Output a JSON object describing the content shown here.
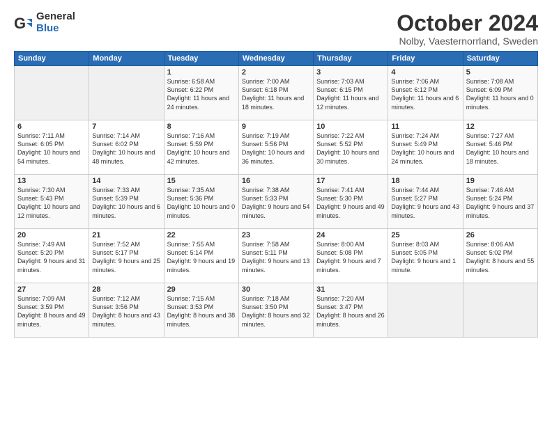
{
  "logo": {
    "general": "General",
    "blue": "Blue"
  },
  "title": "October 2024",
  "location": "Nolby, Vaesternorrland, Sweden",
  "days_header": [
    "Sunday",
    "Monday",
    "Tuesday",
    "Wednesday",
    "Thursday",
    "Friday",
    "Saturday"
  ],
  "weeks": [
    [
      {
        "num": "",
        "sunrise": "",
        "sunset": "",
        "daylight": ""
      },
      {
        "num": "",
        "sunrise": "",
        "sunset": "",
        "daylight": ""
      },
      {
        "num": "1",
        "sunrise": "Sunrise: 6:58 AM",
        "sunset": "Sunset: 6:22 PM",
        "daylight": "Daylight: 11 hours and 24 minutes."
      },
      {
        "num": "2",
        "sunrise": "Sunrise: 7:00 AM",
        "sunset": "Sunset: 6:18 PM",
        "daylight": "Daylight: 11 hours and 18 minutes."
      },
      {
        "num": "3",
        "sunrise": "Sunrise: 7:03 AM",
        "sunset": "Sunset: 6:15 PM",
        "daylight": "Daylight: 11 hours and 12 minutes."
      },
      {
        "num": "4",
        "sunrise": "Sunrise: 7:06 AM",
        "sunset": "Sunset: 6:12 PM",
        "daylight": "Daylight: 11 hours and 6 minutes."
      },
      {
        "num": "5",
        "sunrise": "Sunrise: 7:08 AM",
        "sunset": "Sunset: 6:09 PM",
        "daylight": "Daylight: 11 hours and 0 minutes."
      }
    ],
    [
      {
        "num": "6",
        "sunrise": "Sunrise: 7:11 AM",
        "sunset": "Sunset: 6:05 PM",
        "daylight": "Daylight: 10 hours and 54 minutes."
      },
      {
        "num": "7",
        "sunrise": "Sunrise: 7:14 AM",
        "sunset": "Sunset: 6:02 PM",
        "daylight": "Daylight: 10 hours and 48 minutes."
      },
      {
        "num": "8",
        "sunrise": "Sunrise: 7:16 AM",
        "sunset": "Sunset: 5:59 PM",
        "daylight": "Daylight: 10 hours and 42 minutes."
      },
      {
        "num": "9",
        "sunrise": "Sunrise: 7:19 AM",
        "sunset": "Sunset: 5:56 PM",
        "daylight": "Daylight: 10 hours and 36 minutes."
      },
      {
        "num": "10",
        "sunrise": "Sunrise: 7:22 AM",
        "sunset": "Sunset: 5:52 PM",
        "daylight": "Daylight: 10 hours and 30 minutes."
      },
      {
        "num": "11",
        "sunrise": "Sunrise: 7:24 AM",
        "sunset": "Sunset: 5:49 PM",
        "daylight": "Daylight: 10 hours and 24 minutes."
      },
      {
        "num": "12",
        "sunrise": "Sunrise: 7:27 AM",
        "sunset": "Sunset: 5:46 PM",
        "daylight": "Daylight: 10 hours and 18 minutes."
      }
    ],
    [
      {
        "num": "13",
        "sunrise": "Sunrise: 7:30 AM",
        "sunset": "Sunset: 5:43 PM",
        "daylight": "Daylight: 10 hours and 12 minutes."
      },
      {
        "num": "14",
        "sunrise": "Sunrise: 7:33 AM",
        "sunset": "Sunset: 5:39 PM",
        "daylight": "Daylight: 10 hours and 6 minutes."
      },
      {
        "num": "15",
        "sunrise": "Sunrise: 7:35 AM",
        "sunset": "Sunset: 5:36 PM",
        "daylight": "Daylight: 10 hours and 0 minutes."
      },
      {
        "num": "16",
        "sunrise": "Sunrise: 7:38 AM",
        "sunset": "Sunset: 5:33 PM",
        "daylight": "Daylight: 9 hours and 54 minutes."
      },
      {
        "num": "17",
        "sunrise": "Sunrise: 7:41 AM",
        "sunset": "Sunset: 5:30 PM",
        "daylight": "Daylight: 9 hours and 49 minutes."
      },
      {
        "num": "18",
        "sunrise": "Sunrise: 7:44 AM",
        "sunset": "Sunset: 5:27 PM",
        "daylight": "Daylight: 9 hours and 43 minutes."
      },
      {
        "num": "19",
        "sunrise": "Sunrise: 7:46 AM",
        "sunset": "Sunset: 5:24 PM",
        "daylight": "Daylight: 9 hours and 37 minutes."
      }
    ],
    [
      {
        "num": "20",
        "sunrise": "Sunrise: 7:49 AM",
        "sunset": "Sunset: 5:20 PM",
        "daylight": "Daylight: 9 hours and 31 minutes."
      },
      {
        "num": "21",
        "sunrise": "Sunrise: 7:52 AM",
        "sunset": "Sunset: 5:17 PM",
        "daylight": "Daylight: 9 hours and 25 minutes."
      },
      {
        "num": "22",
        "sunrise": "Sunrise: 7:55 AM",
        "sunset": "Sunset: 5:14 PM",
        "daylight": "Daylight: 9 hours and 19 minutes."
      },
      {
        "num": "23",
        "sunrise": "Sunrise: 7:58 AM",
        "sunset": "Sunset: 5:11 PM",
        "daylight": "Daylight: 9 hours and 13 minutes."
      },
      {
        "num": "24",
        "sunrise": "Sunrise: 8:00 AM",
        "sunset": "Sunset: 5:08 PM",
        "daylight": "Daylight: 9 hours and 7 minutes."
      },
      {
        "num": "25",
        "sunrise": "Sunrise: 8:03 AM",
        "sunset": "Sunset: 5:05 PM",
        "daylight": "Daylight: 9 hours and 1 minute."
      },
      {
        "num": "26",
        "sunrise": "Sunrise: 8:06 AM",
        "sunset": "Sunset: 5:02 PM",
        "daylight": "Daylight: 8 hours and 55 minutes."
      }
    ],
    [
      {
        "num": "27",
        "sunrise": "Sunrise: 7:09 AM",
        "sunset": "Sunset: 3:59 PM",
        "daylight": "Daylight: 8 hours and 49 minutes."
      },
      {
        "num": "28",
        "sunrise": "Sunrise: 7:12 AM",
        "sunset": "Sunset: 3:56 PM",
        "daylight": "Daylight: 8 hours and 43 minutes."
      },
      {
        "num": "29",
        "sunrise": "Sunrise: 7:15 AM",
        "sunset": "Sunset: 3:53 PM",
        "daylight": "Daylight: 8 hours and 38 minutes."
      },
      {
        "num": "30",
        "sunrise": "Sunrise: 7:18 AM",
        "sunset": "Sunset: 3:50 PM",
        "daylight": "Daylight: 8 hours and 32 minutes."
      },
      {
        "num": "31",
        "sunrise": "Sunrise: 7:20 AM",
        "sunset": "Sunset: 3:47 PM",
        "daylight": "Daylight: 8 hours and 26 minutes."
      },
      {
        "num": "",
        "sunrise": "",
        "sunset": "",
        "daylight": ""
      },
      {
        "num": "",
        "sunrise": "",
        "sunset": "",
        "daylight": ""
      }
    ]
  ]
}
